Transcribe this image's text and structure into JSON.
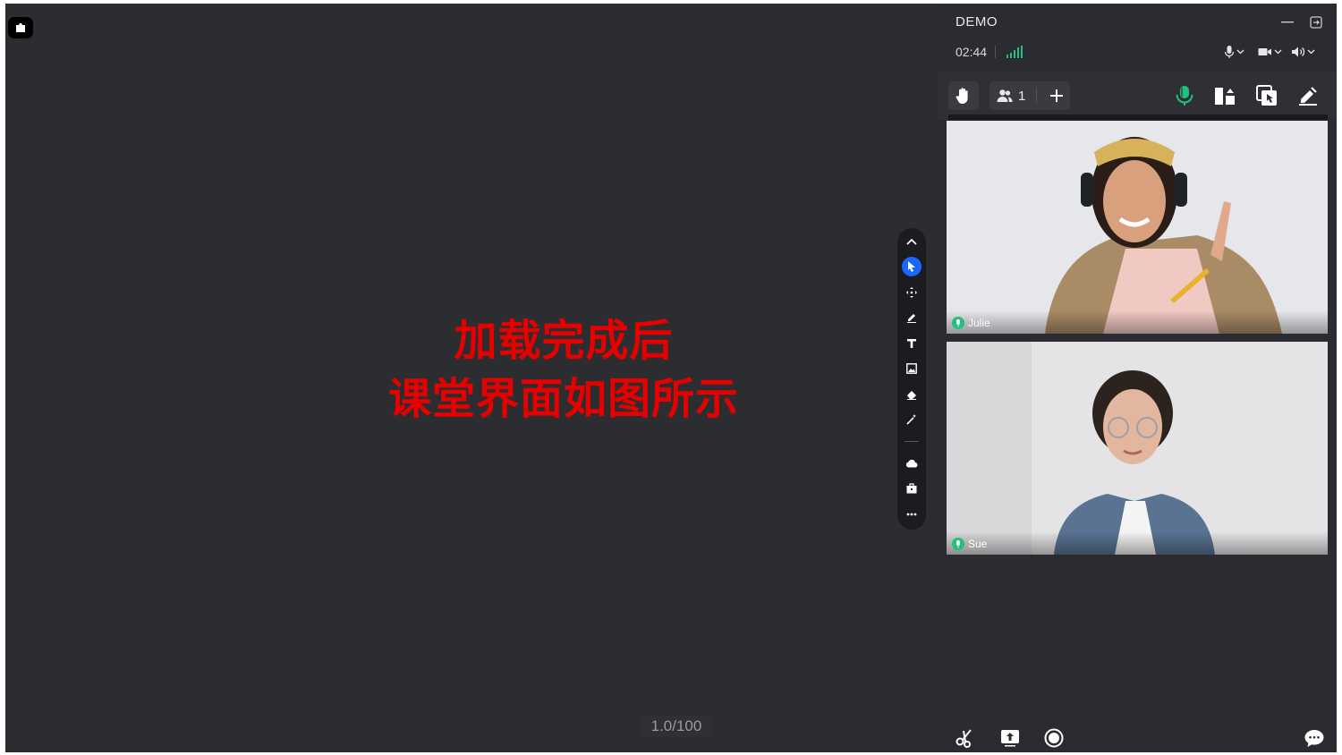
{
  "board": {
    "caption_line1": "加载完成后",
    "caption_line2": "课堂界面如图所示",
    "page_counter": "1.0/100"
  },
  "tool_rail": {
    "tools": [
      "chevron-up-icon",
      "pointer-icon",
      "move-icon",
      "pen-icon",
      "text-icon",
      "image-icon",
      "eraser-icon",
      "magic-wand-icon",
      "cloud-icon",
      "toolbox-icon",
      "more-icon"
    ],
    "active_tool": "pointer-icon"
  },
  "header": {
    "title": "DEMO",
    "timer": "02:44",
    "signal_color": "#1fc17d"
  },
  "toolbar": {
    "member_count": "1"
  },
  "videos": [
    {
      "name": "Julie",
      "mic_color": "#1fc17d"
    },
    {
      "name": "Sue",
      "mic_color": "#1fc17d"
    }
  ],
  "colors": {
    "accent": "#1a66ff",
    "caption": "#e60000",
    "panel_bg": "#2b2c31",
    "board_bg": "#2c2d31"
  }
}
